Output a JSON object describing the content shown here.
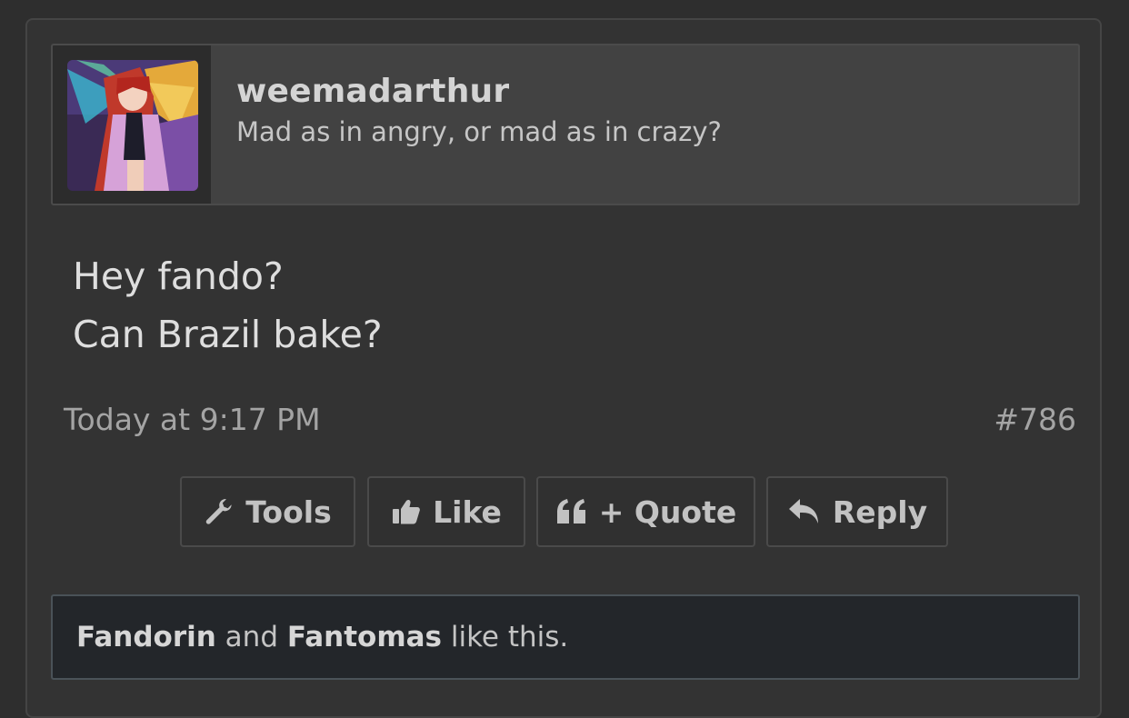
{
  "post": {
    "author": {
      "name": "weemadarthur",
      "title": "Mad as in angry, or mad as in crazy?",
      "avatar_icon": "anime-avatar-image"
    },
    "message_lines": [
      "Hey fando?",
      "Can Brazil bake?"
    ],
    "timestamp": "Today at 9:17 PM",
    "post_number": "#786",
    "actions": {
      "tools": {
        "label": "Tools",
        "icon": "wrench-icon"
      },
      "like": {
        "label": "Like",
        "icon": "thumbs-up-icon"
      },
      "quote": {
        "label": "+ Quote",
        "icon": "quote-icon"
      },
      "reply": {
        "label": "Reply",
        "icon": "reply-arrow-icon"
      }
    },
    "likes": {
      "user1": "Fandorin",
      "connector": " and ",
      "user2": "Fantomas",
      "suffix": " like this."
    }
  },
  "colors": {
    "background": "#2e2e2e",
    "post_background": "#333333",
    "user_block_background": "#424242",
    "likes_bar_background": "#23262a"
  }
}
